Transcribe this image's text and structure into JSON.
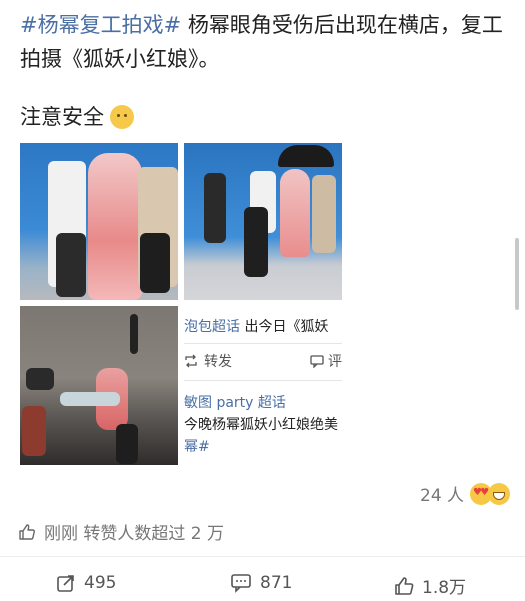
{
  "post": {
    "topic": "#杨幂复工拍戏#",
    "body": " 杨幂眼角受伤后出现在横店，复工拍摄《狐妖小红娘》。",
    "note": "注意安全"
  },
  "card": {
    "line1_link": "泡包超话",
    "line1_text": " 出今日《狐妖",
    "repost_label": "转发",
    "comment_label": "评",
    "line2_link": "敏图 party 超话",
    "line3": "今晚杨幂狐妖小红娘绝美",
    "line4_link": "幂#"
  },
  "engagement": {
    "likes": "24 人",
    "repost_note": "刚刚 转赞人数超过 2 万"
  },
  "actions": {
    "repost_count": "495",
    "comment_count": "871",
    "like_count": "1.8万"
  },
  "colors": {
    "link": "#4a6fa5",
    "muted": "#777777"
  },
  "icons": [
    "thumbs-up-icon",
    "repost-icon",
    "comment-icon",
    "like-icon",
    "shrug-emoji-icon",
    "heart-eyes-emoji-icon",
    "grin-emoji-icon"
  ]
}
